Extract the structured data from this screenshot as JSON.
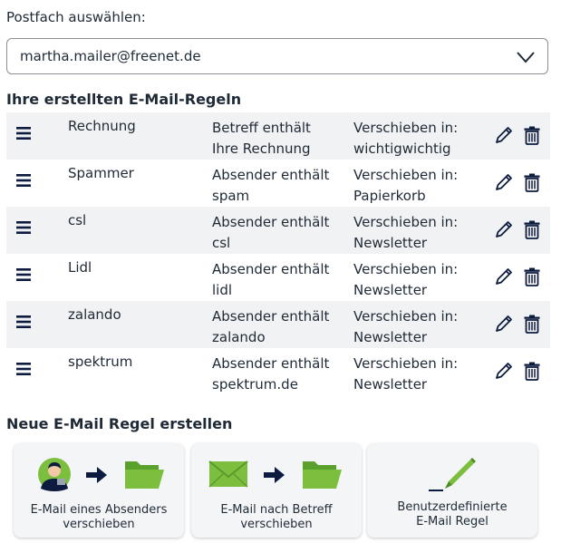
{
  "mailbox": {
    "label": "Postfach auswählen:",
    "selected": "martha.mailer@freenet.de"
  },
  "rules_section": {
    "title": "Ihre erstellten E-Mail-Regeln",
    "rules": [
      {
        "name": "Rechnung",
        "cond_line1": "Betreff enthält",
        "cond_line2": "Ihre Rechnung",
        "act_line1": "Verschieben in:",
        "act_line2": "wichtigwichtig"
      },
      {
        "name": "Spammer",
        "cond_line1": "Absender enthält",
        "cond_line2": "spam",
        "act_line1": "Verschieben in:",
        "act_line2": "Papierkorb"
      },
      {
        "name": "csl",
        "cond_line1": "Absender enthält",
        "cond_line2": "csl",
        "act_line1": "Verschieben in:",
        "act_line2": "Newsletter"
      },
      {
        "name": "Lidl",
        "cond_line1": "Absender enthält",
        "cond_line2": "lidl",
        "act_line1": "Verschieben in:",
        "act_line2": "Newsletter"
      },
      {
        "name": "zalando",
        "cond_line1": "Absender enthält",
        "cond_line2": "zalando",
        "act_line1": "Verschieben in:",
        "act_line2": "Newsletter"
      },
      {
        "name": "spektrum",
        "cond_line1": "Absender enthält",
        "cond_line2": "spektrum.de",
        "act_line1": "Verschieben in:",
        "act_line2": "Newsletter"
      }
    ]
  },
  "new_rule": {
    "title": "Neue E-Mail Regel erstellen",
    "cards": [
      {
        "line1": "E-Mail eines Absenders",
        "line2": "verschieben"
      },
      {
        "line1": "E-Mail nach Betreff",
        "line2": "verschieben"
      },
      {
        "line1": "Benutzerdefinierte",
        "line2": "E-Mail Regel"
      }
    ]
  },
  "colors": {
    "text": "#1f2a37",
    "icon_dark": "#0d1b3e",
    "green": "#7cbf3f",
    "row_alt": "#f1f2f3",
    "card_bg": "#f4f5f6"
  }
}
